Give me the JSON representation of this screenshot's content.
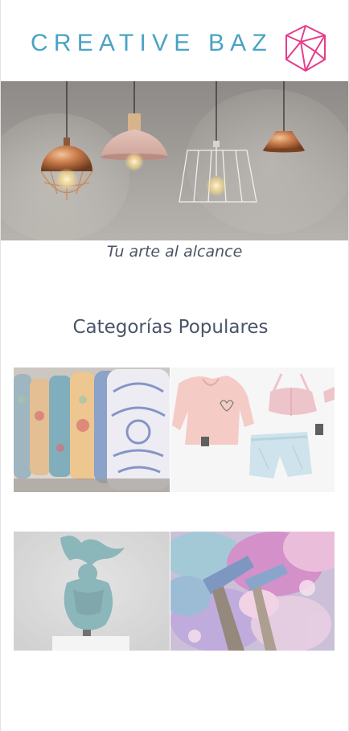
{
  "brand": {
    "name": "CREATIVE BAZ",
    "accent_color": "#4aa3c4",
    "logo_color": "#e63c8c",
    "logo_icon": "geometric-gem-icon"
  },
  "hero": {
    "image": "pendant-lamps-photo",
    "tagline": "Tu arte al alcance"
  },
  "categories": {
    "title": "Categorías Populares",
    "tiles": [
      {
        "image": "painted-ceramic-vases-photo"
      },
      {
        "image": "pink-clothing-flatlay-photo"
      },
      {
        "image": "turquoise-sculpture-photo"
      },
      {
        "image": "paint-palette-brushes-photo"
      }
    ]
  }
}
